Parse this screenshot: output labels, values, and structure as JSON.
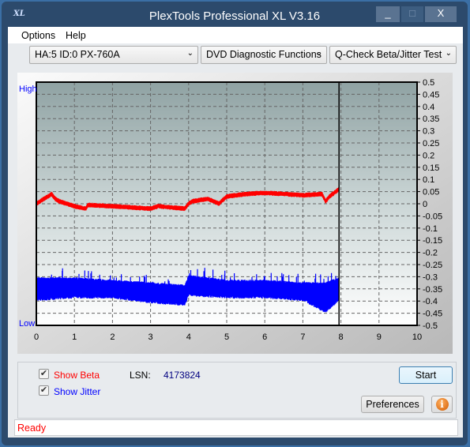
{
  "window": {
    "title": "PlexTools Professional XL V3.16",
    "logo": "XL",
    "minimize": "_",
    "maximize": "□",
    "close": "X"
  },
  "menu": [
    {
      "label": "Options",
      "accel": "O"
    },
    {
      "label": "Help",
      "accel": "H"
    }
  ],
  "toolbar": {
    "drive": "HA:5 ID:0  PX-760A",
    "function": "DVD Diagnostic Functions",
    "test": "Q-Check Beta/Jitter Test"
  },
  "chart_data": {
    "type": "line",
    "xlim": [
      0,
      10
    ],
    "ylim": [
      -0.5,
      0.5
    ],
    "x_ticks": [
      "0",
      "1",
      "2",
      "3",
      "4",
      "5",
      "6",
      "7",
      "8",
      "9",
      "10"
    ],
    "y_ticks": [
      "0.5",
      "0.45",
      "0.4",
      "0.35",
      "0.3",
      "0.25",
      "0.2",
      "0.15",
      "0.1",
      "0.05",
      "0",
      "-0.05",
      "-0.1",
      "-0.15",
      "-0.2",
      "-0.25",
      "-0.3",
      "-0.35",
      "-0.4",
      "-0.45",
      "-0.5"
    ],
    "left_labels": {
      "high": "High",
      "low": "Low"
    },
    "grid": true,
    "cursor_x": 7.95,
    "series": [
      {
        "key": "beta",
        "color": "#ff0000",
        "points": [
          [
            0,
            0.0
          ],
          [
            0.2,
            0.02
          ],
          [
            0.4,
            0.04
          ],
          [
            0.5,
            0.02
          ],
          [
            0.6,
            0.01
          ],
          [
            1.0,
            -0.01
          ],
          [
            1.3,
            -0.02
          ],
          [
            1.35,
            -0.005
          ],
          [
            2,
            -0.01
          ],
          [
            3,
            -0.02
          ],
          [
            3.2,
            -0.01
          ],
          [
            3.9,
            -0.02
          ],
          [
            4.0,
            0.0
          ],
          [
            4.1,
            0.01
          ],
          [
            4.5,
            0.02
          ],
          [
            4.8,
            0.0
          ],
          [
            5.0,
            0.03
          ],
          [
            5.5,
            0.04
          ],
          [
            6,
            0.045
          ],
          [
            7,
            0.035
          ],
          [
            7.5,
            0.04
          ],
          [
            7.6,
            0.01
          ],
          [
            7.7,
            0.03
          ],
          [
            7.95,
            0.06
          ]
        ]
      },
      {
        "key": "jitter",
        "color": "#0000ff",
        "bands": [
          [
            0,
            -0.39,
            -0.31
          ],
          [
            1,
            -0.38,
            -0.31
          ],
          [
            2,
            -0.38,
            -0.32
          ],
          [
            3,
            -0.4,
            -0.33
          ],
          [
            3.9,
            -0.41,
            -0.34
          ],
          [
            4.0,
            -0.37,
            -0.3
          ],
          [
            5,
            -0.38,
            -0.32
          ],
          [
            6,
            -0.38,
            -0.32
          ],
          [
            7,
            -0.39,
            -0.33
          ],
          [
            7.6,
            -0.44,
            -0.33
          ],
          [
            7.95,
            -0.39,
            -0.31
          ]
        ]
      }
    ]
  },
  "controls": {
    "show_beta": "Show Beta",
    "show_beta_checked": true,
    "show_jitter": "Show Jitter",
    "show_jitter_checked": true,
    "lsn_label": "LSN:",
    "lsn_value": "4173824",
    "start": "Start",
    "preferences": "Preferences",
    "info_icon": "info-icon"
  },
  "colors": {
    "beta": "#ff0000",
    "jitter": "#0000ff",
    "lsn": "#000080"
  },
  "status": "Ready"
}
